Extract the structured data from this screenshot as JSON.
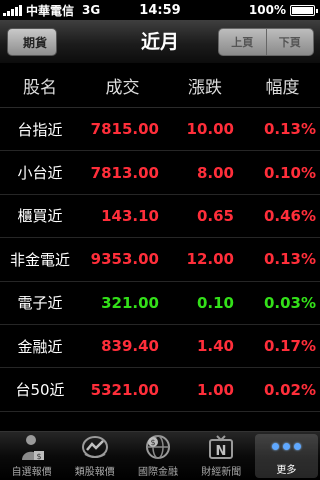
{
  "status_bar": {
    "carrier": "中華電信",
    "network": "3G",
    "time": "14:59",
    "battery": "100%",
    "battery_level": 1.0
  },
  "nav": {
    "back_label": "期貨",
    "title": "近月",
    "prev_label": "上頁",
    "next_label": "下頁"
  },
  "table": {
    "headers": [
      "股名",
      "成交",
      "漲跌",
      "幅度"
    ],
    "rows": [
      {
        "name": "台指近",
        "price": "7815.00",
        "change": "10.00",
        "pct": "0.13%",
        "dir": "up"
      },
      {
        "name": "小台近",
        "price": "7813.00",
        "change": "8.00",
        "pct": "0.10%",
        "dir": "up"
      },
      {
        "name": "櫃買近",
        "price": "143.10",
        "change": "0.65",
        "pct": "0.46%",
        "dir": "up"
      },
      {
        "name": "非金電近",
        "price": "9353.00",
        "change": "12.00",
        "pct": "0.13%",
        "dir": "up"
      },
      {
        "name": "電子近",
        "price": "321.00",
        "change": "0.10",
        "pct": "0.03%",
        "dir": "down"
      },
      {
        "name": "金融近",
        "price": "839.40",
        "change": "1.40",
        "pct": "0.17%",
        "dir": "up"
      },
      {
        "name": "台50近",
        "price": "5321.00",
        "change": "1.00",
        "pct": "0.02%",
        "dir": "up"
      }
    ]
  },
  "tabs": [
    {
      "label": "自選報價",
      "icon": "person-chart-icon"
    },
    {
      "label": "類股報價",
      "icon": "sector-chart-icon"
    },
    {
      "label": "國際金融",
      "icon": "globe-dollar-icon"
    },
    {
      "label": "財經新聞",
      "icon": "news-tv-icon"
    },
    {
      "label": "更多",
      "icon": "more-dots-icon",
      "active": true
    }
  ],
  "colors": {
    "up": "#ff2e3a",
    "down": "#33e019"
  }
}
